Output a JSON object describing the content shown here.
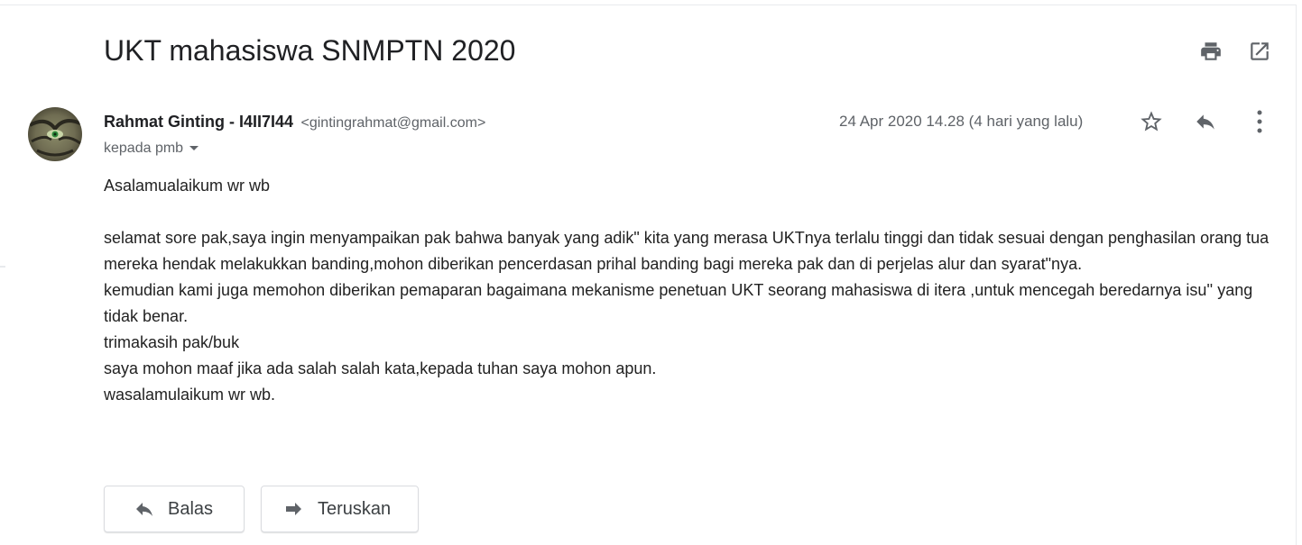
{
  "subject": "UKT mahasiswa SNMPTN 2020",
  "toolbar": {
    "print_icon": "print-icon",
    "open_new_window_icon": "open-in-new-window-icon"
  },
  "message": {
    "sender_name": "Rahmat Ginting - I4II7I44",
    "sender_email": "<gintingrahmat@gmail.com>",
    "recipient": "kepada pmb",
    "date": "24 Apr 2020 14.28 (4 hari yang lalu)",
    "actions": [
      "star-icon",
      "reply-icon",
      "more-vert-icon"
    ],
    "body_lines": [
      "Asalamualaikum wr wb",
      "",
      "selamat sore pak,saya ingin menyampaikan pak bahwa banyak yang adik\" kita yang merasa UKTnya terlalu tinggi dan tidak sesuai dengan penghasilan orang tua mereka hendak melakukkan banding,mohon diberikan pencerdasan prihal banding bagi mereka pak dan di perjelas alur dan syarat\"nya.",
      "kemudian kami juga memohon diberikan pemaparan bagaimana mekanisme penetuan UKT seorang mahasiswa di itera ,untuk mencegah beredarnya isu'' yang tidak benar.",
      "trimakasih pak/buk",
      "saya mohon maaf jika ada salah salah kata,kepada tuhan saya mohon apun.",
      "wasalamulaikum wr wb."
    ]
  },
  "bottom_actions": {
    "reply_label": "Balas",
    "forward_label": "Teruskan"
  },
  "colors": {
    "text_primary": "#202124",
    "text_secondary": "#5f6368",
    "icon": "#5f6368",
    "border": "#dadce0"
  }
}
